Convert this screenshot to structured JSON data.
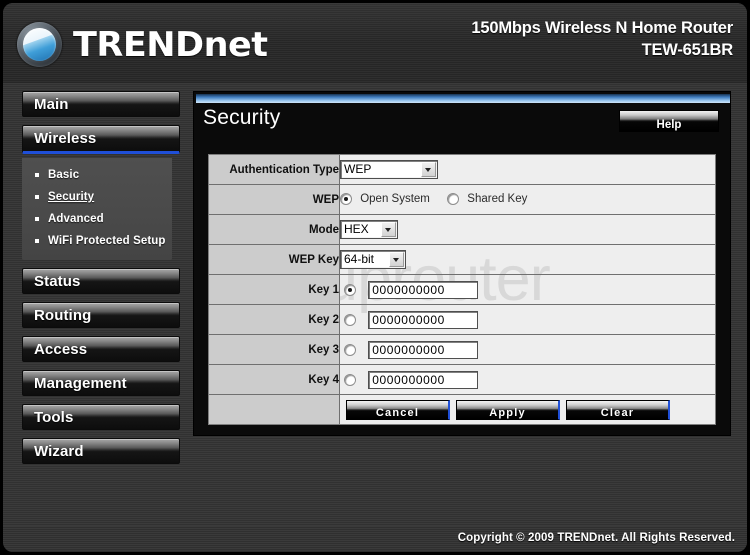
{
  "header": {
    "brand": "TRENDnet",
    "product_line": "150Mbps Wireless N Home Router",
    "model": "TEW-651BR"
  },
  "sidebar": {
    "items": [
      {
        "label": "Main",
        "active": false
      },
      {
        "label": "Wireless",
        "active": true
      },
      {
        "label": "Status",
        "active": false
      },
      {
        "label": "Routing",
        "active": false
      },
      {
        "label": "Access",
        "active": false
      },
      {
        "label": "Management",
        "active": false
      },
      {
        "label": "Tools",
        "active": false
      },
      {
        "label": "Wizard",
        "active": false
      }
    ],
    "subitems": [
      {
        "label": "Basic",
        "current": false
      },
      {
        "label": "Security",
        "current": true
      },
      {
        "label": "Advanced",
        "current": false
      },
      {
        "label": "WiFi Protected Setup",
        "current": false
      }
    ]
  },
  "panel": {
    "title": "Security",
    "help_label": "Help",
    "watermark": "setuprouter"
  },
  "form": {
    "auth_type": {
      "label": "Authentication Type",
      "value": "WEP",
      "options": [
        "WEP"
      ]
    },
    "wep": {
      "label": "WEP",
      "options": [
        {
          "label": "Open System",
          "selected": true
        },
        {
          "label": "Shared Key",
          "selected": false
        }
      ]
    },
    "mode": {
      "label": "Mode",
      "value": "HEX",
      "options": [
        "HEX"
      ]
    },
    "wep_key": {
      "label": "WEP Key",
      "value": "64-bit",
      "options": [
        "64-bit"
      ]
    },
    "keys": [
      {
        "label": "Key 1",
        "value": "0000000000",
        "selected": true
      },
      {
        "label": "Key 2",
        "value": "0000000000",
        "selected": false
      },
      {
        "label": "Key 3",
        "value": "0000000000",
        "selected": false
      },
      {
        "label": "Key 4",
        "value": "0000000000",
        "selected": false
      }
    ],
    "buttons": {
      "cancel": "Cancel",
      "apply": "Apply",
      "clear": "Clear"
    }
  },
  "footer": {
    "copyright": "Copyright © 2009 TRENDnet. All Rights Reserved."
  }
}
